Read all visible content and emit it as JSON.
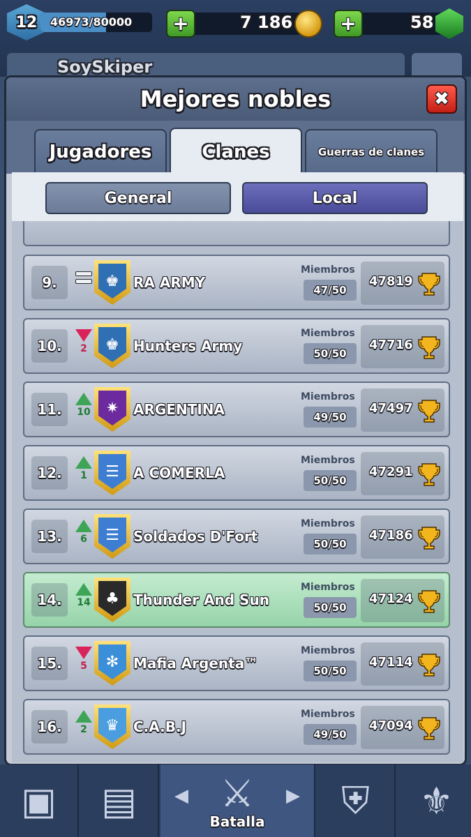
{
  "hud": {
    "level": "12",
    "xp": "46973/80000",
    "xp_progress": 0.587,
    "gold": "7 186",
    "gems": "58",
    "plus_symbol": "+",
    "profile_name": "SoySkiper"
  },
  "modal": {
    "title": "Mejores nobles",
    "close_symbol": "✖",
    "tabs": [
      {
        "label": "Jugadores",
        "active": false
      },
      {
        "label": "Clanes",
        "active": true
      },
      {
        "label": "Guerras de clanes",
        "active": false
      }
    ],
    "subtabs": [
      {
        "label": "General",
        "active": false
      },
      {
        "label": "Local",
        "active": true
      }
    ],
    "members_label": "Miembros",
    "clans": [
      {
        "rank": "9.",
        "change": "same",
        "change_value": "",
        "badge_icon": "king-icon",
        "badge_color": "#2f6fb4",
        "name": "RA ARMY",
        "members": "47/50",
        "trophies": "47819",
        "highlight": false
      },
      {
        "rank": "10.",
        "change": "down",
        "change_value": "2",
        "badge_icon": "king-icon",
        "badge_color": "#2f6fb4",
        "name": "Hunters Army",
        "members": "50/50",
        "trophies": "47716",
        "highlight": false
      },
      {
        "rank": "11.",
        "change": "up",
        "change_value": "10",
        "badge_icon": "star-icon",
        "badge_color": "#6b2a9e",
        "name": "ARGENTINA",
        "members": "49/50",
        "trophies": "47497",
        "highlight": false
      },
      {
        "rank": "12.",
        "change": "up",
        "change_value": "1",
        "badge_icon": "stripes-icon",
        "badge_color": "#3d7ed2",
        "name": "A COMERLA",
        "members": "50/50",
        "trophies": "47291",
        "highlight": false
      },
      {
        "rank": "13.",
        "change": "up",
        "change_value": "6",
        "badge_icon": "stripes-icon",
        "badge_color": "#3d7ed2",
        "name": "Soldados D'Fort",
        "members": "50/50",
        "trophies": "47186",
        "highlight": false
      },
      {
        "rank": "14.",
        "change": "up",
        "change_value": "14",
        "badge_icon": "clover-icon",
        "badge_color": "#2a2a2a",
        "name": "Thunder And Sun",
        "members": "50/50",
        "trophies": "47124",
        "highlight": true
      },
      {
        "rank": "15.",
        "change": "down",
        "change_value": "5",
        "badge_icon": "snowflake-icon",
        "badge_color": "#3b8fd8",
        "name": "Mafia Argenta™",
        "members": "50/50",
        "trophies": "47114",
        "highlight": false
      },
      {
        "rank": "16.",
        "change": "up",
        "change_value": "2",
        "badge_icon": "crown-icon",
        "badge_color": "#4a9ee0",
        "name": "C.A.B.J",
        "members": "49/50",
        "trophies": "47094",
        "highlight": false
      }
    ]
  },
  "nav": {
    "items": [
      {
        "icon": "chest-icon",
        "glyph": "▣"
      },
      {
        "icon": "cards-icon",
        "glyph": "▤"
      },
      {
        "icon": "battle-icon",
        "glyph": "⚔",
        "label": "Batalla",
        "active": true
      },
      {
        "icon": "clan-icon",
        "glyph": "⛨"
      },
      {
        "icon": "tournament-icon",
        "glyph": "⚜"
      }
    ],
    "arrow_left": "◀",
    "arrow_right": "▶"
  },
  "colors": {
    "arrow_up": "#3ea556",
    "arrow_down": "#d8245a",
    "highlight_row": "#a9dcb6",
    "active_subtab": "#5a5cab"
  }
}
